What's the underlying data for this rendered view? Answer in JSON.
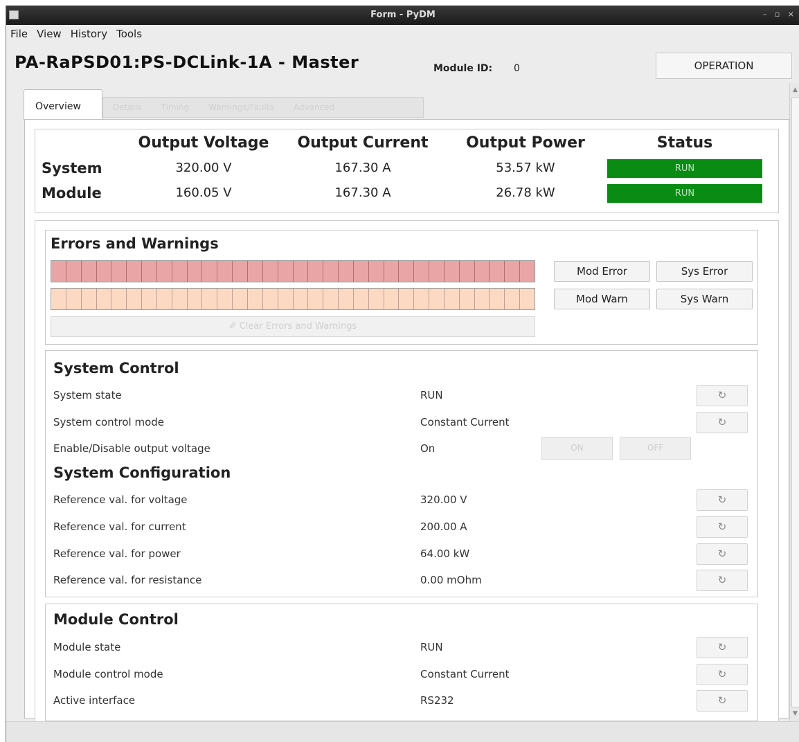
{
  "window": {
    "title": "Form - PyDM",
    "controls": "– ▫ ×"
  },
  "menubar": {
    "items": [
      "File",
      "View",
      "History",
      "Tools"
    ]
  },
  "header": {
    "title": "PA-RaPSD01:PS-DCLink-1A - Master",
    "module_id_label": "Module ID:",
    "module_id_value": "0",
    "operation_mode": "OPERATION"
  },
  "tabs": {
    "active": "Overview",
    "disabled": [
      "Details",
      "Timing",
      "Warnings/Faults",
      "Advanced"
    ]
  },
  "overview": {
    "headers": [
      "Output Voltage",
      "Output Current",
      "Output Power",
      "Status"
    ],
    "rows": [
      {
        "label": "System",
        "voltage": "320.00 V",
        "current": "167.30 A",
        "power": "53.57 kW",
        "status": "RUN"
      },
      {
        "label": "Module",
        "voltage": "160.05 V",
        "current": "167.30 A",
        "power": "26.78 kW",
        "status": "RUN"
      }
    ],
    "status_color": "#0a8c14"
  },
  "errors": {
    "title": "Errors and Warnings",
    "led_count": 32,
    "error_led_color": "#e9a5a5",
    "warning_led_color": "#fbd9c3",
    "buttons": {
      "mod_error": "Mod Error",
      "sys_error": "Sys Error",
      "mod_warn": "Mod Warn",
      "sys_warn": "Sys Warn"
    },
    "clear_label": "Clear Errors and Warnings"
  },
  "system_control": {
    "title": "System Control",
    "rows": [
      {
        "label": "System state",
        "value": "RUN"
      },
      {
        "label": "System control mode",
        "value": "Constant Current"
      },
      {
        "label": "Enable/Disable output voltage",
        "value": "On"
      }
    ],
    "on_label": "ON",
    "off_label": "OFF",
    "refresh_icon": "↻"
  },
  "system_configuration": {
    "title": "System Configuration",
    "rows": [
      {
        "label": "Reference val. for voltage",
        "value": "320.00 V"
      },
      {
        "label": "Reference val. for current",
        "value": "200.00 A"
      },
      {
        "label": "Reference val. for power",
        "value": "64.00 kW"
      },
      {
        "label": "Reference val. for resistance",
        "value": "0.00 mOhm"
      }
    ]
  },
  "module_control": {
    "title": "Module Control",
    "rows": [
      {
        "label": "Module state",
        "value": "RUN"
      },
      {
        "label": "Module control mode",
        "value": "Constant Current"
      },
      {
        "label": "Active interface",
        "value": "RS232"
      }
    ]
  }
}
